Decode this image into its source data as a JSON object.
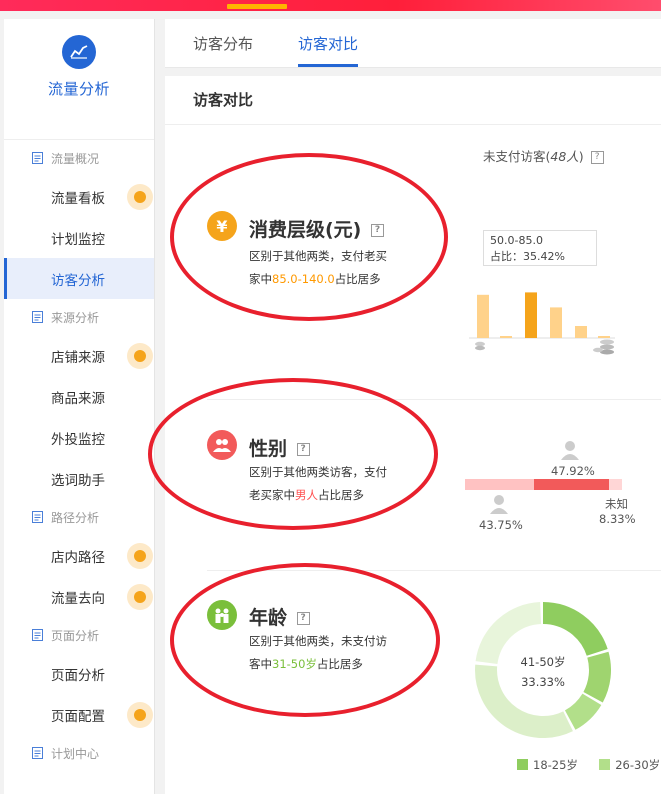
{
  "sidebar": {
    "title": "流量分析",
    "groups": [
      {
        "label": "流量概况",
        "items": [
          {
            "label": "流量看板",
            "dot": true
          },
          {
            "label": "计划监控",
            "dot": false
          },
          {
            "label": "访客分析",
            "dot": false,
            "active": true
          }
        ]
      },
      {
        "label": "来源分析",
        "items": [
          {
            "label": "店铺来源",
            "dot": true
          },
          {
            "label": "商品来源",
            "dot": false
          },
          {
            "label": "外投监控",
            "dot": false
          },
          {
            "label": "选词助手",
            "dot": false
          }
        ]
      },
      {
        "label": "路径分析",
        "items": [
          {
            "label": "店内路径",
            "dot": true
          },
          {
            "label": "流量去向",
            "dot": true
          }
        ]
      },
      {
        "label": "页面分析",
        "items": [
          {
            "label": "页面分析",
            "dot": false
          },
          {
            "label": "页面配置",
            "dot": true
          }
        ]
      },
      {
        "label": "计划中心",
        "items": []
      }
    ]
  },
  "tabs": {
    "visitor_distribution": "访客分布",
    "visitor_compare": "访客对比"
  },
  "main": {
    "title": "访客对比",
    "unpaid_prefix": "未支付访客(",
    "unpaid_count": "48人",
    "unpaid_suffix": ")",
    "qmark": "?"
  },
  "consumption": {
    "icon": "¥",
    "title": "消费层级(元)",
    "desc_1": "区别于其他两类，支付老买",
    "desc_2_pre": "家中",
    "desc_2_hl": "85.0-140.0",
    "desc_2_post": "占比居多",
    "tooltip_range": "50.0-85.0",
    "tooltip_ratio": "占比：35.42%",
    "bars": [
      0.72,
      0.03,
      0.76,
      0.51,
      0.2,
      0.03
    ],
    "highlight_index": 2
  },
  "gender": {
    "title": "性别",
    "desc_1": "区别于其他两类访客，支付",
    "desc_2_pre": "老买家中",
    "desc_2_hl": "男人",
    "desc_2_post": "占比居多",
    "male_pct": "47.92%",
    "female_pct": "43.75%",
    "unknown_label": "未知",
    "unknown_pct": "8.33%",
    "shares": [
      43.75,
      47.92,
      8.33
    ],
    "colors": {
      "female": "#ffc2c2",
      "male": "#f25a5a",
      "unknown": "#ffd6d6"
    }
  },
  "age": {
    "title": "年龄",
    "desc_1": "区别于其他两类，未支付访",
    "desc_2_pre": "客中",
    "desc_2_hl": "31-50岁",
    "desc_2_post": "占比居多",
    "center_label": "41-50岁",
    "center_pct": "33.33%",
    "legend": [
      {
        "label": "18-25岁",
        "color": "#8fcd5f"
      },
      {
        "label": "26-30岁",
        "color": "#b2df8a"
      }
    ]
  },
  "colors": {
    "accent": "#2466d4",
    "annotation": "#e8202d",
    "orange": "#f5a41b"
  }
}
